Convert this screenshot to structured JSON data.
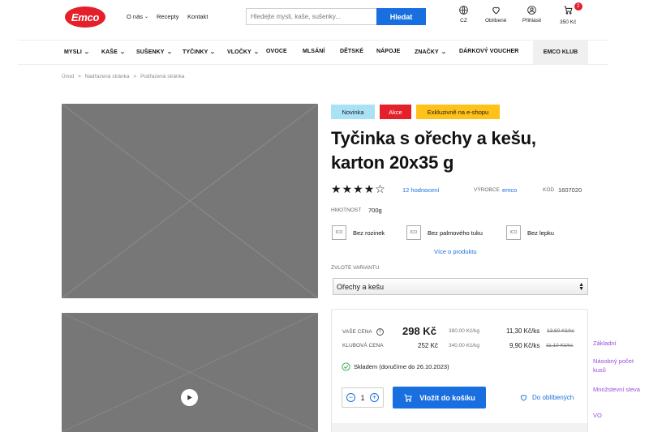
{
  "header": {
    "logo": "Emco",
    "nav": [
      "O nás",
      "Recepty",
      "Kontakt"
    ],
    "search_placeholder": "Hledejte mysli, kaše, sušenky...",
    "search_button": "Hledat",
    "lang": "CZ",
    "favorites": "Oblíbené",
    "login": "Přihlásit",
    "cart_price": "350 Kč",
    "cart_count": "2"
  },
  "categories": [
    "MYSLI",
    "KAŠE",
    "SUŠENKY",
    "TYČINKY",
    "VLOČKY",
    "OVOCE",
    "MLSÁNÍ",
    "DĚTSKÉ",
    "NÁPOJE",
    "ZNAČKY",
    "DÁRKOVÝ VOUCHER",
    "EMCO KLUB"
  ],
  "breadcrumb": [
    "Úvod",
    "Nadřazená stránka",
    "Podřazená stránka"
  ],
  "breadcrumb_sep": ">",
  "badges": {
    "new": "Novinka",
    "sale": "Akce",
    "exclusive": "Exkluzivně na e-shopu"
  },
  "colors": {
    "new": "#a9e2f5",
    "sale": "#e4202a",
    "exclusive": "#ffc21a",
    "accent": "#1a6fe0"
  },
  "product": {
    "title": "Tyčinka s ořechy a kešu, karton 20x35 g",
    "rating": 4,
    "rating_max": 5,
    "reviews": "12 hodnocení",
    "manufacturer_label": "VÝROBCE",
    "manufacturer": "emco",
    "code_label": "KÓD",
    "code": "1607020",
    "weight_label": "HMOTNOST",
    "weight": "700g",
    "feature_icon": "ICO",
    "features": [
      "Bez rozinek",
      "Bez palmového tuku",
      "Bez lepku"
    ],
    "more_link": "Více o produktu",
    "variant_label": "ZVLOTE VARIANTU",
    "variant_value": "Ořechy a kešu"
  },
  "price": {
    "your_label": "VAŠE CENA",
    "your_price": "298 Kč",
    "your_unit": "380,00 Kč/kg",
    "your_bulk": "11,30 Kč/ks",
    "your_old": "13,60 Kč/ks",
    "club_label": "KLUBOVÁ CENA",
    "club_price": "252 Kč",
    "club_unit": "340,00 Kč/kg",
    "club_bulk": "9,90 Kč/ks",
    "club_old": "11,10 Kč/ks",
    "stock": "Skladem (doručíme do 26.10.2023)",
    "qty": "1",
    "cart_button": "Vložit do košíku",
    "fav_button": "Do oblíbených"
  },
  "side_links": [
    "Základní",
    "Násobný počet kusů",
    "Množstevní sleva",
    "VO"
  ]
}
